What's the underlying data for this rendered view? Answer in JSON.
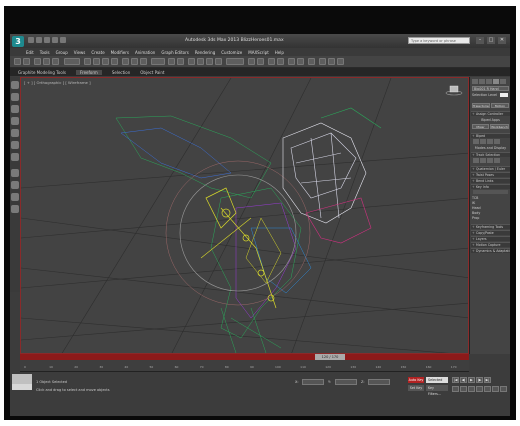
{
  "app": {
    "title": "Autodesk 3ds Max 2013   BlizzHeroes01.max",
    "search_placeholder": "Type a keyword or phrase",
    "logo_letter": "3",
    "window_controls": [
      "–",
      "□",
      "✕"
    ]
  },
  "menu": [
    "Edit",
    "Tools",
    "Group",
    "Views",
    "Create",
    "Modifiers",
    "Animation",
    "Graph Editors",
    "Rendering",
    "Customize",
    "MAXScript",
    "Help"
  ],
  "ribbon": {
    "tabs": [
      "Graphite Modeling Tools",
      "Freeform",
      "Selection",
      "Object Paint"
    ],
    "active": "Freeform"
  },
  "viewport": {
    "label": "[ + ] [ Orthographic ] [ Wireframe ]",
    "border_color": "#8a2a2a"
  },
  "command_panel": {
    "object_name": "Bip001 R Hand",
    "modifier_list": "Selection Level",
    "rows": [
      {
        "text": "Trajectories",
        "type": "button"
      },
      {
        "text": "Motion",
        "type": "button"
      },
      {
        "text": "Assign Controller",
        "type": "rollout"
      },
      {
        "text": "Biped Apps",
        "type": "text"
      },
      {
        "text": "Mixer",
        "type": "button"
      },
      {
        "text": "Workbench",
        "type": "button"
      },
      {
        "text": "Biped",
        "type": "rollout"
      },
      {
        "text": "Modes and Display",
        "type": "text"
      },
      {
        "text": "Track Selection",
        "type": "rollout"
      },
      {
        "text": "Quaternion / Euler",
        "type": "rollout"
      },
      {
        "text": "Twist Poses",
        "type": "rollout"
      },
      {
        "text": "Bend Links",
        "type": "rollout"
      },
      {
        "text": "Key Info",
        "type": "rollout"
      },
      {
        "text": "TCB",
        "type": "text"
      },
      {
        "text": "IK",
        "type": "text"
      },
      {
        "text": "Head",
        "type": "text"
      },
      {
        "text": "Body",
        "type": "text"
      },
      {
        "text": "Prop",
        "type": "text"
      },
      {
        "text": "Keyframing Tools",
        "type": "rollout"
      },
      {
        "text": "Copy/Paste",
        "type": "rollout"
      },
      {
        "text": "Layers",
        "type": "rollout"
      },
      {
        "text": "Motion Capture",
        "type": "rollout"
      },
      {
        "text": "Dynamics & Adaptation",
        "type": "rollout"
      }
    ]
  },
  "timeline": {
    "slider_label": "120 / 170",
    "frame_progress": 0.705,
    "ticks": [
      "0",
      "10",
      "20",
      "30",
      "40",
      "50",
      "60",
      "70",
      "80",
      "90",
      "100",
      "110",
      "120",
      "130",
      "140",
      "150",
      "160",
      "170"
    ]
  },
  "status": {
    "line1": "1 Object Selected",
    "line2": "Click and drag to select and move objects",
    "x_label": "X:",
    "y_label": "Y:",
    "z_label": "Z:",
    "auto_key": "Auto Key",
    "set_key": "Set Key",
    "selected": "Selected",
    "key_filters": "Key Filters...",
    "playback": [
      "|◀",
      "◀|",
      "▶",
      "|▶",
      "▶|"
    ]
  },
  "colors": {
    "auto_key": "#b22222",
    "time_slider": "#8c1a1a",
    "logo": "#1e8a8f"
  }
}
